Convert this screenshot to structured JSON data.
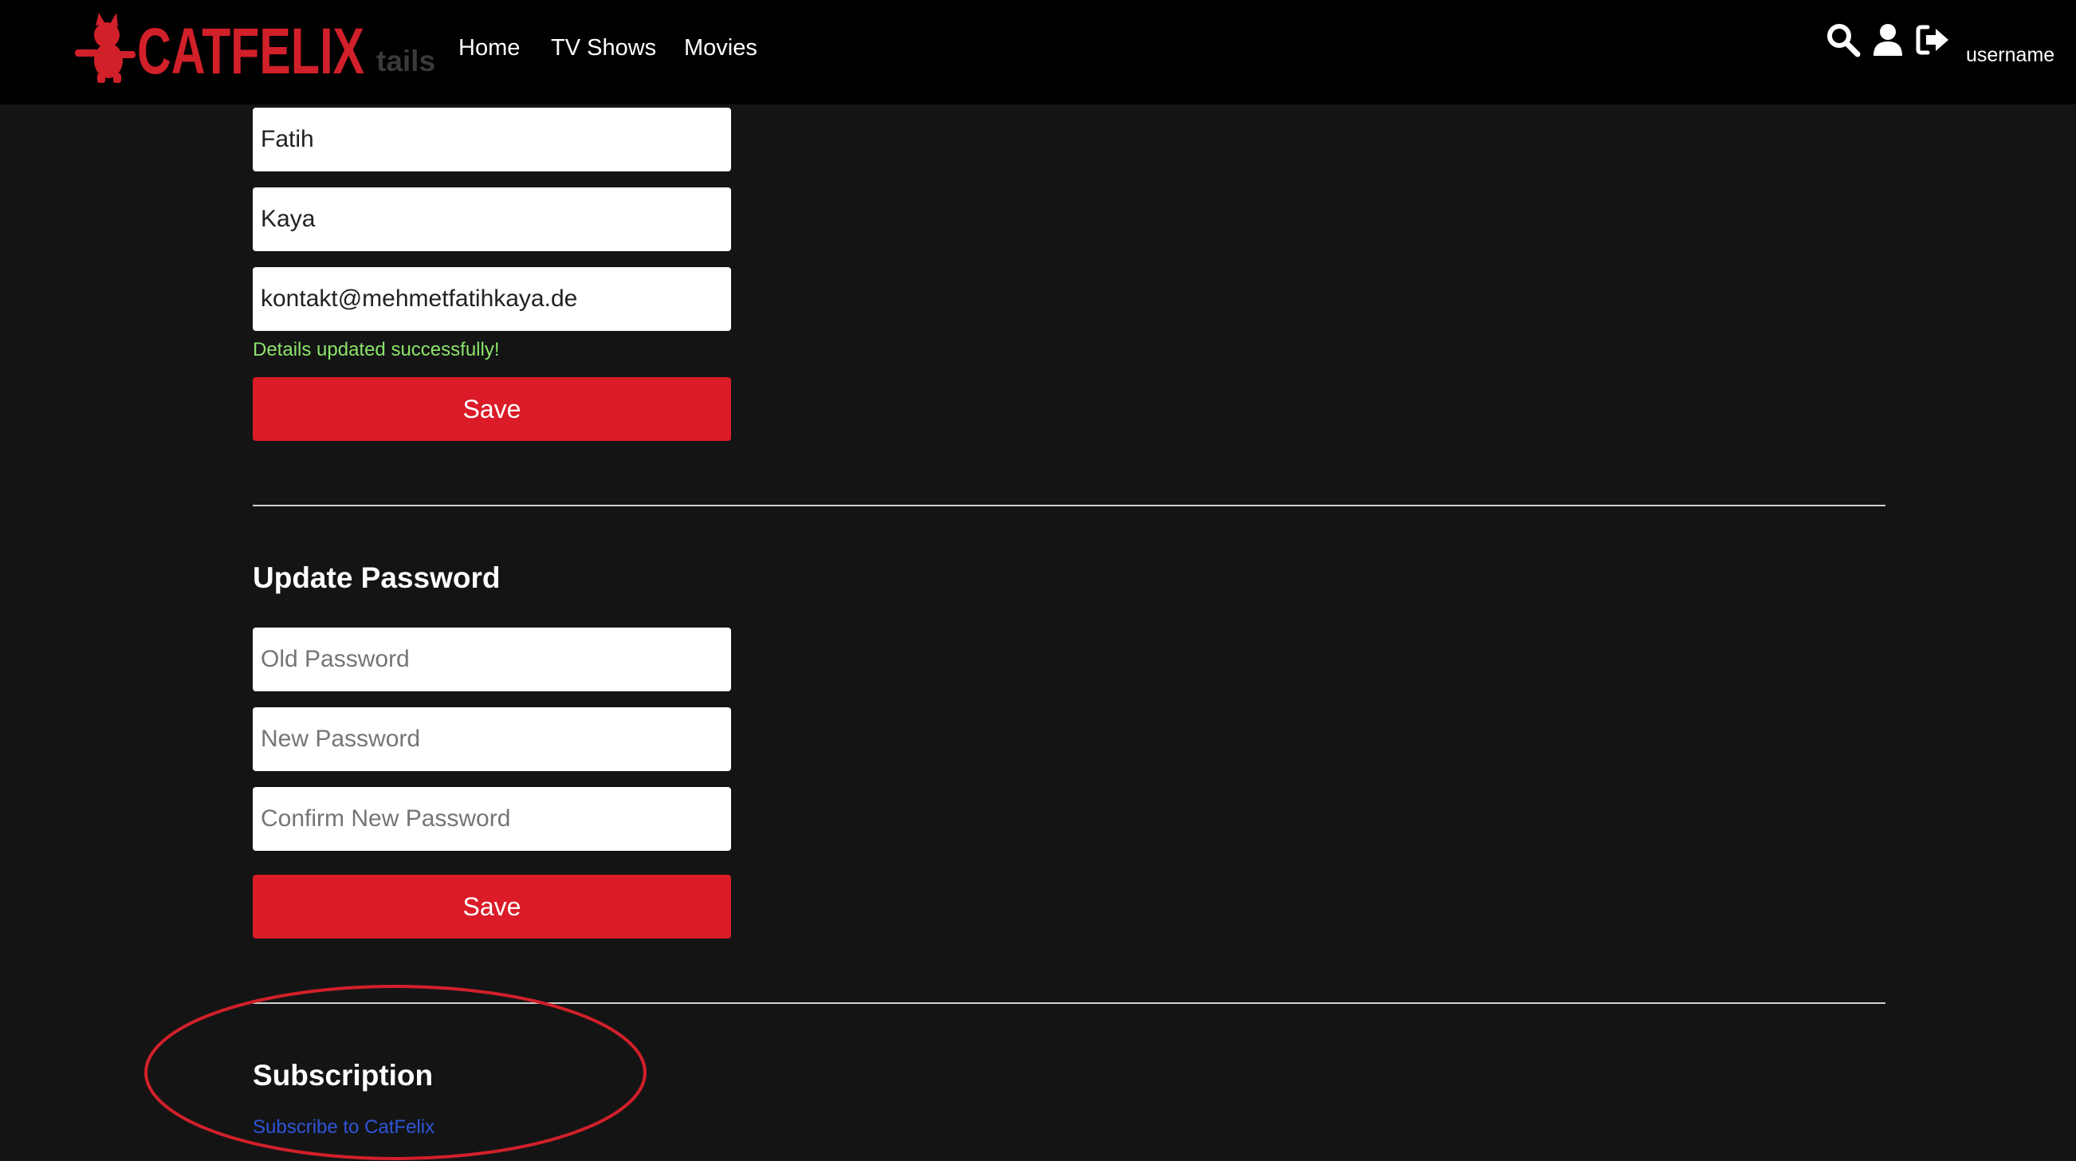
{
  "header": {
    "logo_text": "CATFELIX",
    "nav": [
      "Home",
      "TV Shows",
      "Movies"
    ],
    "icons": [
      "search-icon",
      "user-icon",
      "sign-out-icon"
    ],
    "username": "username"
  },
  "account_details": {
    "title_partial": "tails",
    "first_name": "Fatih",
    "last_name": "Kaya",
    "email": "kontakt@mehmetfatihkaya.de",
    "success_message": "Details updated successfully!",
    "save_label": "Save"
  },
  "update_password": {
    "title": "Update Password",
    "old_placeholder": "Old Password",
    "new_placeholder": "New Password",
    "confirm_placeholder": "Confirm New Password",
    "save_label": "Save"
  },
  "subscription": {
    "title": "Subscription",
    "link_text": "Subscribe to CatFelix"
  },
  "colors": {
    "background": "#141414",
    "header": "#000000",
    "accent": "#db1b28",
    "success": "#8ce36b",
    "link": "#2f55d6",
    "annotation": "#d1202a"
  }
}
